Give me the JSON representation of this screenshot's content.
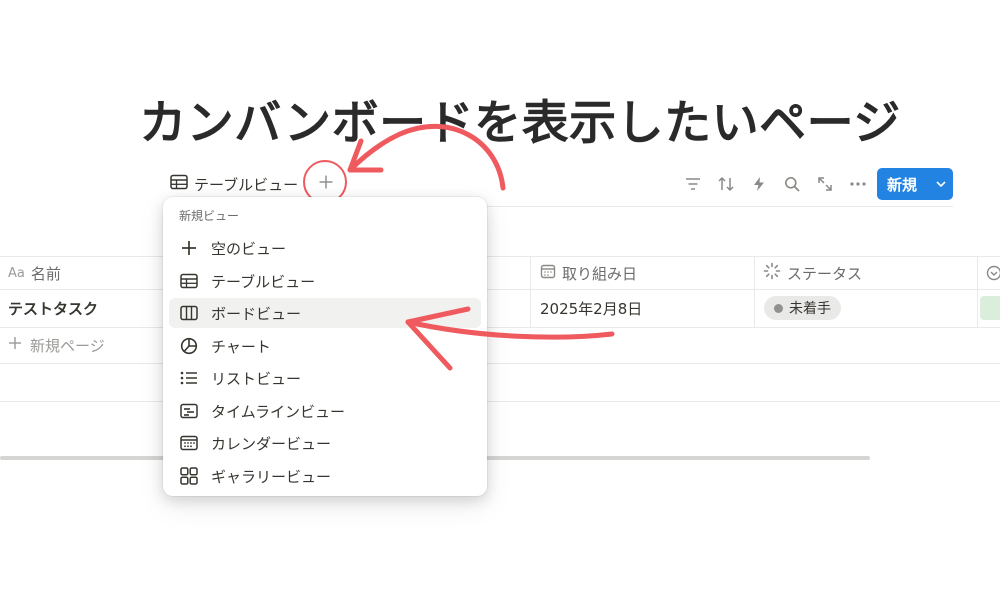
{
  "page": {
    "title": "カンバンボードを表示したいページ"
  },
  "view_tabs": {
    "active_label": "テーブルビュー",
    "add_icon": "plus-icon"
  },
  "toolbar": {
    "icons": [
      "filter-icon",
      "sort-icon",
      "automation-icon",
      "search-icon",
      "expand-icon",
      "more-icon"
    ],
    "new_button_label": "新規"
  },
  "table": {
    "columns": [
      {
        "icon": "Aa",
        "label": "名前"
      },
      {
        "icon": "calendar-icon",
        "label": "取り組み日"
      },
      {
        "icon": "status-icon",
        "label": "ステータス"
      }
    ],
    "rows": [
      {
        "name": "テストタスク",
        "date": "2025年2月8日",
        "status": "未着手"
      }
    ],
    "new_page_label": "新規ページ"
  },
  "view_menu": {
    "header": "新規ビュー",
    "items": [
      {
        "label": "空のビュー",
        "icon": "plus-icon"
      },
      {
        "label": "テーブルビュー",
        "icon": "table-icon"
      },
      {
        "label": "ボードビュー",
        "icon": "board-icon"
      },
      {
        "label": "チャート",
        "icon": "chart-icon"
      },
      {
        "label": "リストビュー",
        "icon": "list-icon"
      },
      {
        "label": "タイムラインビュー",
        "icon": "timeline-icon"
      },
      {
        "label": "カレンダービュー",
        "icon": "calendar-icon"
      },
      {
        "label": "ギャラリービュー",
        "icon": "gallery-icon"
      }
    ]
  },
  "colors": {
    "accent": "#2383e2",
    "annotation": "#ef5a5f",
    "status_dot": "#91918e"
  }
}
